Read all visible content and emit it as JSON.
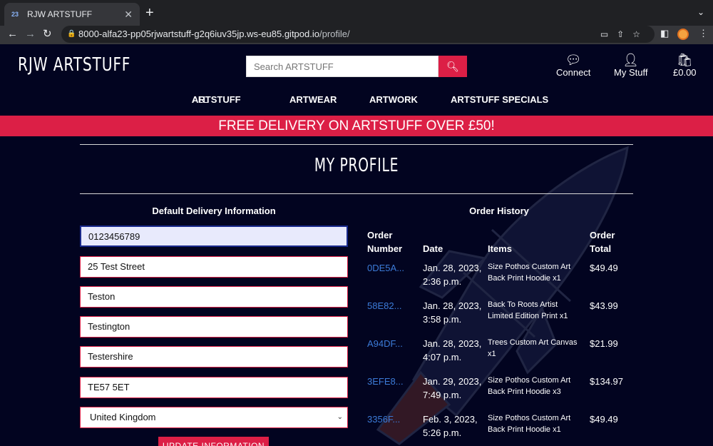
{
  "browser": {
    "tab_title": "RJW ARTSTUFF",
    "tab_favicon": "gitpod-favicon",
    "url_host": "8000-alfa23-pp05rjwartstuff-g2q6iuv35jp.ws-eu85.gitpod.io",
    "url_path": "/profile/"
  },
  "header": {
    "logo": "RJW ARTSTUFF",
    "search_placeholder": "Search ARTSTUFF",
    "connect_label": "Connect",
    "mystuff_label": "My Stuff",
    "basket_total": "£0.00"
  },
  "mainnav": {
    "all_prefix": "ALL",
    "all_label": "ARTSTUFF",
    "artwear": "ARTWEAR",
    "artwork": "ARTWORK",
    "specials": "ARTSTUFF SPECIALS"
  },
  "banner": "FREE DELIVERY ON ARTSTUFF OVER £50!",
  "profile": {
    "title": "MY PROFILE",
    "delivery_heading": "Default Delivery Information",
    "orders_heading": "Order History",
    "fields": {
      "phone": "0123456789",
      "street1": "25 Test Street",
      "street2": "Teston",
      "town": "Testington",
      "county": "Testershire",
      "postcode": "TE57 5ET",
      "country": "United Kingdom"
    },
    "update_button": "UPDATE INFORMATION"
  },
  "orders": {
    "headers": {
      "number_1": "Order",
      "number_2": "Number",
      "date": "Date",
      "items": "Items",
      "total_1": "Order",
      "total_2": "Total"
    },
    "rows": [
      {
        "number": "0DE5A...",
        "date_1": "Jan. 28, 2023,",
        "date_2": "2:36 p.m.",
        "items_1": "Size Pothos Custom Art",
        "items_2": "Back Print Hoodie x1",
        "total": "$49.49"
      },
      {
        "number": "58E82...",
        "date_1": "Jan. 28, 2023,",
        "date_2": "3:58 p.m.",
        "items_1": "Back To Roots Artist",
        "items_2": "Limited Edition Print x1",
        "total": "$43.99"
      },
      {
        "number": "A94DF...",
        "date_1": "Jan. 28, 2023,",
        "date_2": "4:07 p.m.",
        "items_1": "Trees Custom Art Canvas",
        "items_2": "x1",
        "total": "$21.99"
      },
      {
        "number": "3EFE8...",
        "date_1": "Jan. 29, 2023,",
        "date_2": "7:49 p.m.",
        "items_1": "Size Pothos Custom Art",
        "items_2": "Back Print Hoodie x3",
        "total": "$134.97"
      },
      {
        "number": "3356F...",
        "date_1": "Feb. 3, 2023,",
        "date_2": "5:26 p.m.",
        "items_1": "Size Pothos Custom Art",
        "items_2": "Back Print Hoodie x1",
        "total": "$49.49"
      }
    ]
  }
}
